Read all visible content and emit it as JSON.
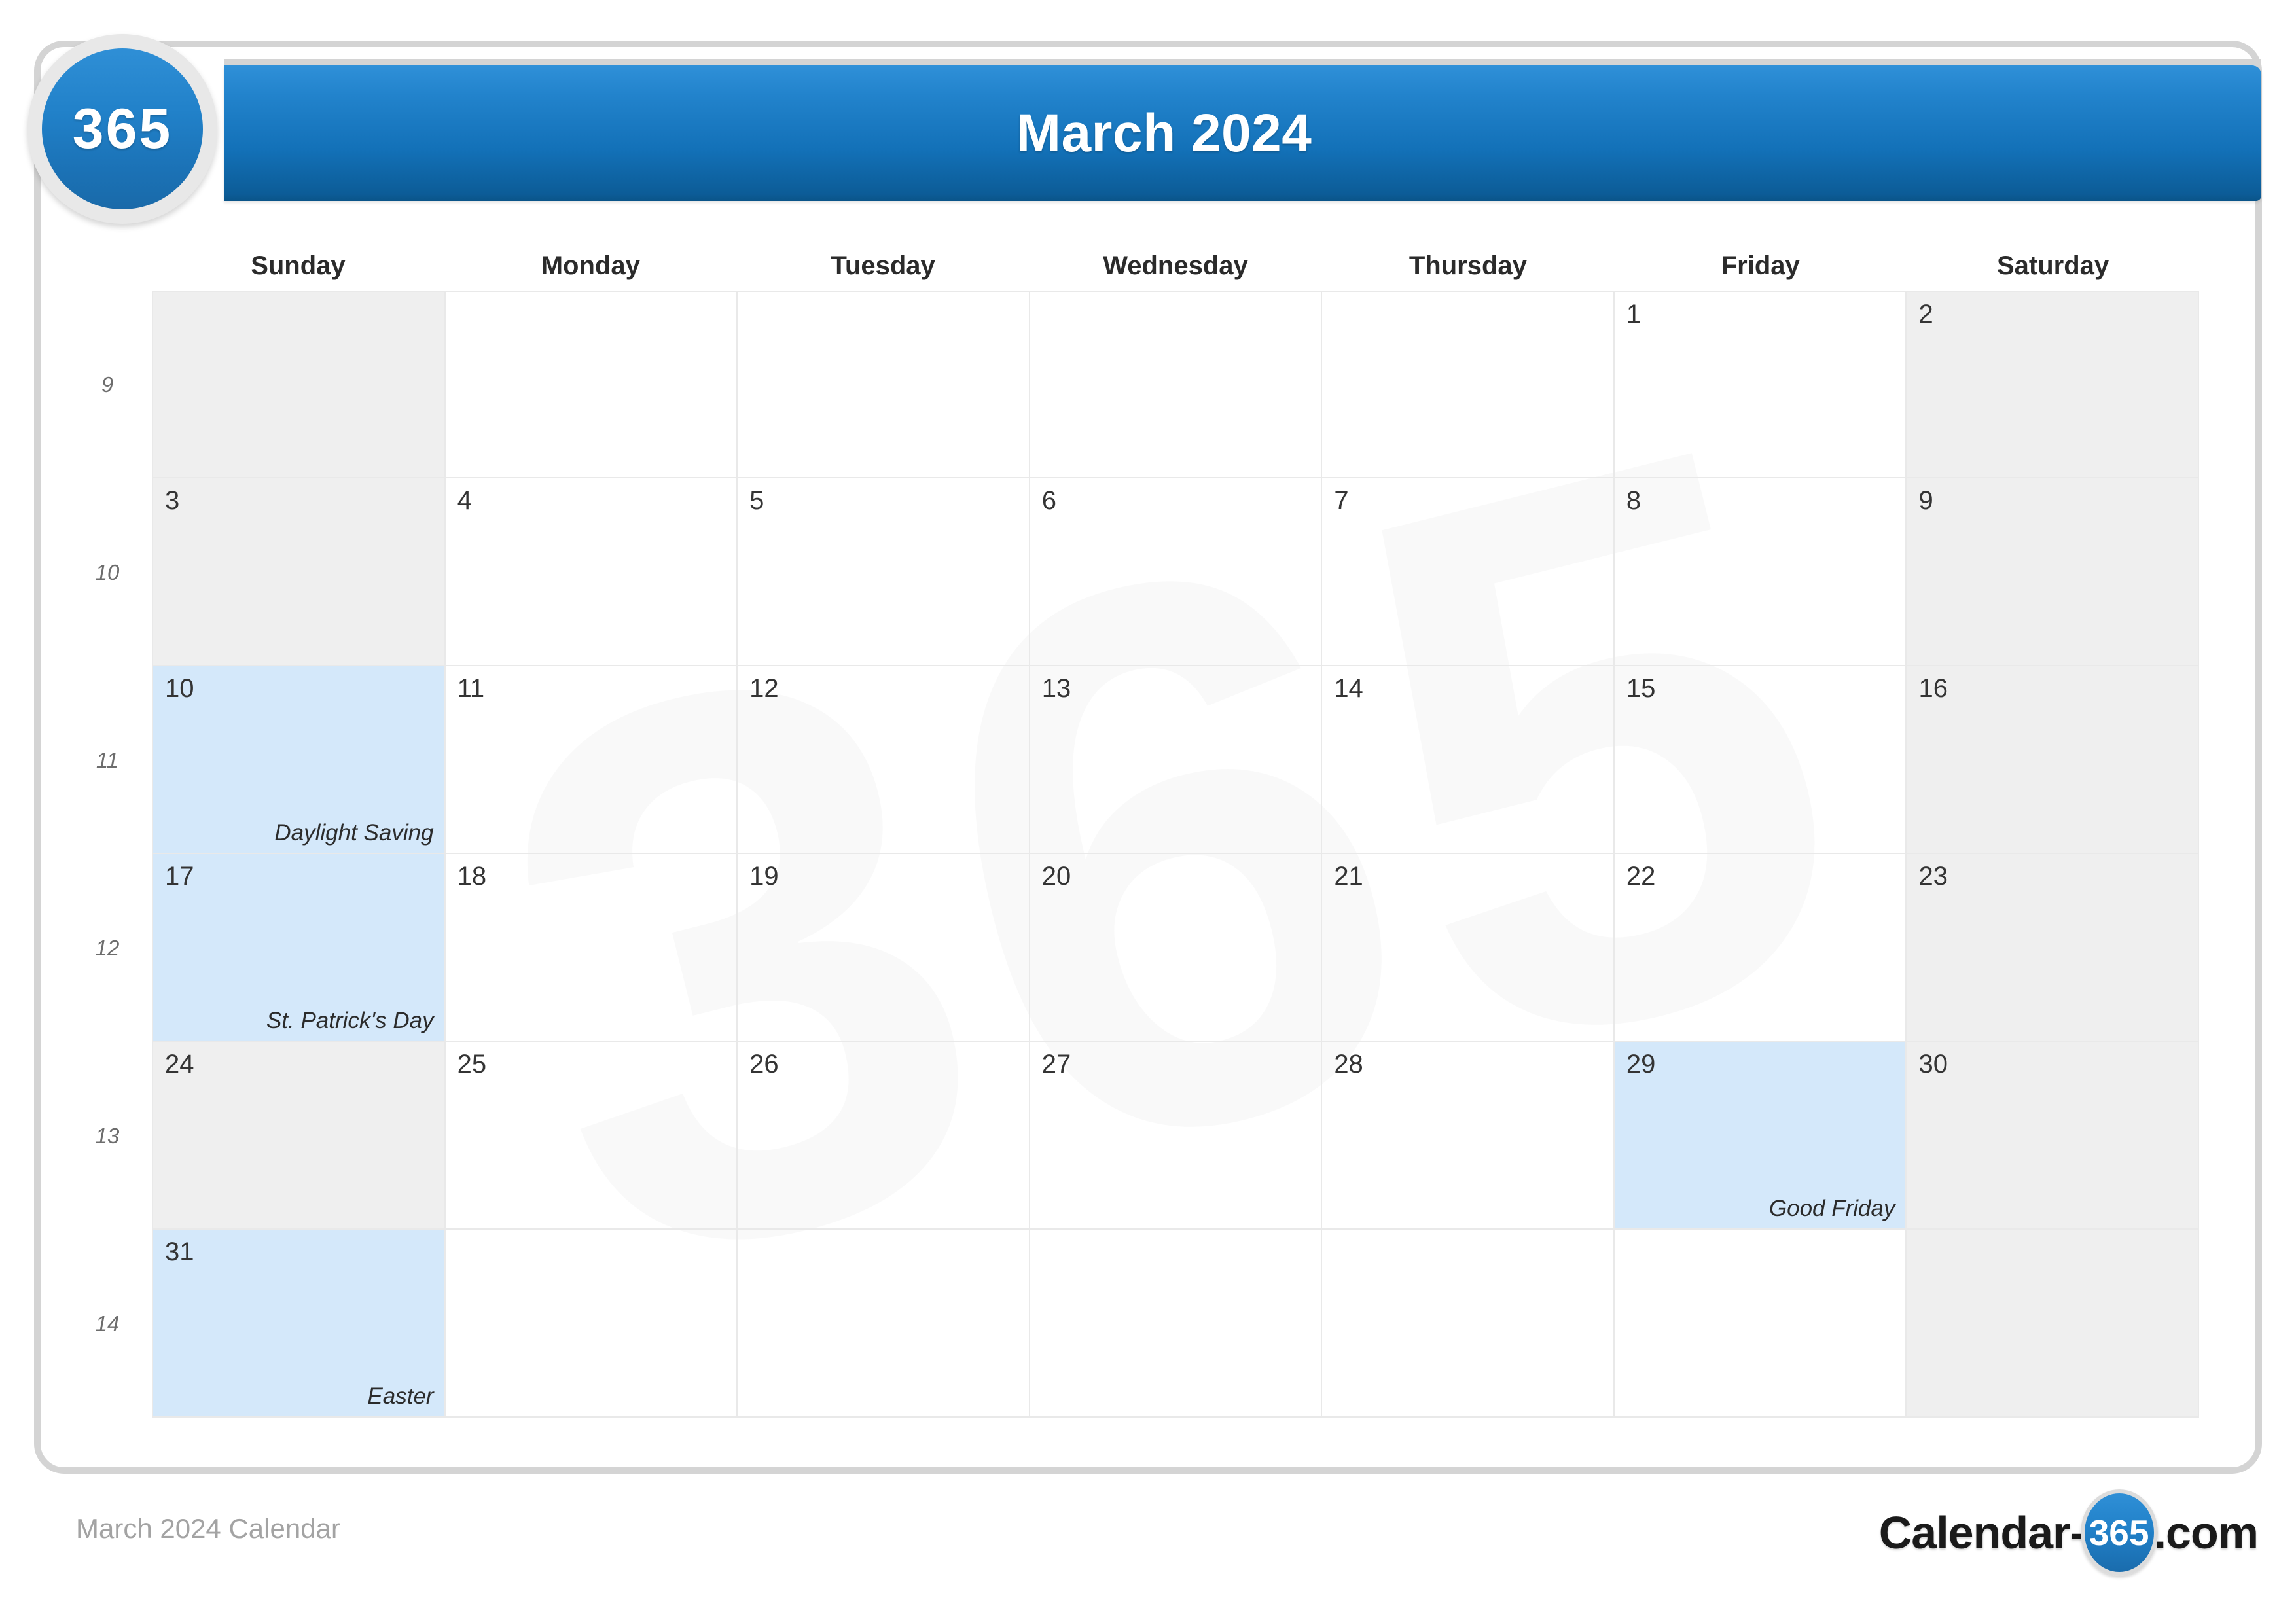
{
  "logo": {
    "badge_text": "365"
  },
  "header": {
    "title": "March 2024"
  },
  "weekdays": [
    "Sunday",
    "Monday",
    "Tuesday",
    "Wednesday",
    "Thursday",
    "Friday",
    "Saturday"
  ],
  "week_numbers": [
    "9",
    "10",
    "11",
    "12",
    "13",
    "14"
  ],
  "watermark_text": "365",
  "weeks": [
    {
      "number": "9",
      "days": [
        {
          "date": "",
          "event": "",
          "weekend": true,
          "holiday": false,
          "blank": true
        },
        {
          "date": "",
          "event": "",
          "weekend": false,
          "holiday": false,
          "blank": true
        },
        {
          "date": "",
          "event": "",
          "weekend": false,
          "holiday": false,
          "blank": true
        },
        {
          "date": "",
          "event": "",
          "weekend": false,
          "holiday": false,
          "blank": true
        },
        {
          "date": "",
          "event": "",
          "weekend": false,
          "holiday": false,
          "blank": true
        },
        {
          "date": "1",
          "event": "",
          "weekend": false,
          "holiday": false,
          "blank": false
        },
        {
          "date": "2",
          "event": "",
          "weekend": true,
          "holiday": false,
          "blank": false
        }
      ]
    },
    {
      "number": "10",
      "days": [
        {
          "date": "3",
          "event": "",
          "weekend": true,
          "holiday": false,
          "blank": false
        },
        {
          "date": "4",
          "event": "",
          "weekend": false,
          "holiday": false,
          "blank": false
        },
        {
          "date": "5",
          "event": "",
          "weekend": false,
          "holiday": false,
          "blank": false
        },
        {
          "date": "6",
          "event": "",
          "weekend": false,
          "holiday": false,
          "blank": false
        },
        {
          "date": "7",
          "event": "",
          "weekend": false,
          "holiday": false,
          "blank": false
        },
        {
          "date": "8",
          "event": "",
          "weekend": false,
          "holiday": false,
          "blank": false
        },
        {
          "date": "9",
          "event": "",
          "weekend": true,
          "holiday": false,
          "blank": false
        }
      ]
    },
    {
      "number": "11",
      "days": [
        {
          "date": "10",
          "event": "Daylight Saving",
          "weekend": true,
          "holiday": true,
          "blank": false
        },
        {
          "date": "11",
          "event": "",
          "weekend": false,
          "holiday": false,
          "blank": false
        },
        {
          "date": "12",
          "event": "",
          "weekend": false,
          "holiday": false,
          "blank": false
        },
        {
          "date": "13",
          "event": "",
          "weekend": false,
          "holiday": false,
          "blank": false
        },
        {
          "date": "14",
          "event": "",
          "weekend": false,
          "holiday": false,
          "blank": false
        },
        {
          "date": "15",
          "event": "",
          "weekend": false,
          "holiday": false,
          "blank": false
        },
        {
          "date": "16",
          "event": "",
          "weekend": true,
          "holiday": false,
          "blank": false
        }
      ]
    },
    {
      "number": "12",
      "days": [
        {
          "date": "17",
          "event": "St. Patrick's Day",
          "weekend": true,
          "holiday": true,
          "blank": false
        },
        {
          "date": "18",
          "event": "",
          "weekend": false,
          "holiday": false,
          "blank": false
        },
        {
          "date": "19",
          "event": "",
          "weekend": false,
          "holiday": false,
          "blank": false
        },
        {
          "date": "20",
          "event": "",
          "weekend": false,
          "holiday": false,
          "blank": false
        },
        {
          "date": "21",
          "event": "",
          "weekend": false,
          "holiday": false,
          "blank": false
        },
        {
          "date": "22",
          "event": "",
          "weekend": false,
          "holiday": false,
          "blank": false
        },
        {
          "date": "23",
          "event": "",
          "weekend": true,
          "holiday": false,
          "blank": false
        }
      ]
    },
    {
      "number": "13",
      "days": [
        {
          "date": "24",
          "event": "",
          "weekend": true,
          "holiday": false,
          "blank": false
        },
        {
          "date": "25",
          "event": "",
          "weekend": false,
          "holiday": false,
          "blank": false
        },
        {
          "date": "26",
          "event": "",
          "weekend": false,
          "holiday": false,
          "blank": false
        },
        {
          "date": "27",
          "event": "",
          "weekend": false,
          "holiday": false,
          "blank": false
        },
        {
          "date": "28",
          "event": "",
          "weekend": false,
          "holiday": false,
          "blank": false
        },
        {
          "date": "29",
          "event": "Good Friday",
          "weekend": false,
          "holiday": true,
          "blank": false
        },
        {
          "date": "30",
          "event": "",
          "weekend": true,
          "holiday": false,
          "blank": false
        }
      ]
    },
    {
      "number": "14",
      "days": [
        {
          "date": "31",
          "event": "Easter",
          "weekend": true,
          "holiday": true,
          "blank": false
        },
        {
          "date": "",
          "event": "",
          "weekend": false,
          "holiday": false,
          "blank": true
        },
        {
          "date": "",
          "event": "",
          "weekend": false,
          "holiday": false,
          "blank": true
        },
        {
          "date": "",
          "event": "",
          "weekend": false,
          "holiday": false,
          "blank": true
        },
        {
          "date": "",
          "event": "",
          "weekend": false,
          "holiday": false,
          "blank": true
        },
        {
          "date": "",
          "event": "",
          "weekend": false,
          "holiday": false,
          "blank": true
        },
        {
          "date": "",
          "event": "",
          "weekend": true,
          "holiday": false,
          "blank": true
        }
      ]
    }
  ],
  "footer": {
    "left_text": "March 2024 Calendar",
    "logo_prefix": "Calendar-",
    "logo_badge": "365",
    "logo_suffix": ".com"
  },
  "colors": {
    "header_blue_light": "#2f90d8",
    "header_blue_dark": "#0a5488",
    "weekend_gray": "#efefef",
    "holiday_blue": "#d4e8fa",
    "grid_line": "#e9e9e9",
    "card_border": "#d4d4d4"
  }
}
